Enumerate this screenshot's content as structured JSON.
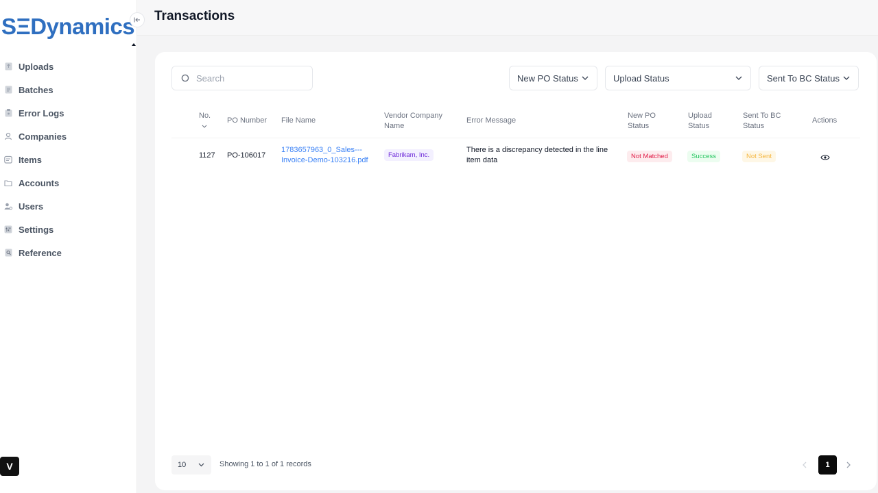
{
  "brand": {
    "logo_prefix": "SΞ",
    "logo_suffix": "Dynamics",
    "color": "#2f6fc0"
  },
  "sidebar": {
    "items": [
      {
        "label": "Uploads",
        "icon": "upload-icon"
      },
      {
        "label": "Batches",
        "icon": "batch-icon"
      },
      {
        "label": "Error Logs",
        "icon": "error-log-icon"
      },
      {
        "label": "Companies",
        "icon": "companies-icon"
      },
      {
        "label": "Items",
        "icon": "items-icon"
      },
      {
        "label": "Accounts",
        "icon": "accounts-icon"
      },
      {
        "label": "Users",
        "icon": "users-icon"
      },
      {
        "label": "Settings",
        "icon": "settings-icon"
      },
      {
        "label": "Reference",
        "icon": "reference-icon"
      }
    ],
    "user_initial": "V"
  },
  "header": {
    "title": "Transactions"
  },
  "filters": {
    "search_placeholder": "Search",
    "new_po_status": "New PO Status",
    "upload_status": "Upload Status",
    "sent_to_bc_status": "Sent To BC Status"
  },
  "table": {
    "columns": {
      "no": "No.",
      "po_number": "PO Number",
      "file_name": "File Name",
      "vendor_line1": "Vendor Company",
      "vendor_line2": "Name",
      "error_message": "Error Message",
      "new_po_line1": "New PO",
      "new_po_line2": "Status",
      "upload_line1": "Upload",
      "upload_line2": "Status",
      "sent_line1": "Sent To BC",
      "sent_line2": "Status",
      "actions": "Actions"
    },
    "rows": [
      {
        "no": "1127",
        "po_number": "PO-106017",
        "file_line1": "1783657963_0_Sales---",
        "file_line2": "Invoice-Demo-103216.pdf",
        "vendor": "Fabrikam, Inc.",
        "error_line1": "There is a discrepancy detected in the line",
        "error_line2": "item data",
        "new_po_status": "Not Matched",
        "upload_status": "Success",
        "sent_to_bc_status": "Not Sent"
      }
    ]
  },
  "footer": {
    "page_size": "10",
    "records_text": "Showing 1 to 1 of 1 records",
    "current_page": "1"
  },
  "colors": {
    "accent": "#3b82f6",
    "danger": "#e11d48",
    "success": "#22c55e",
    "warning": "#f5b53d",
    "vendor": "#6d28d9"
  }
}
